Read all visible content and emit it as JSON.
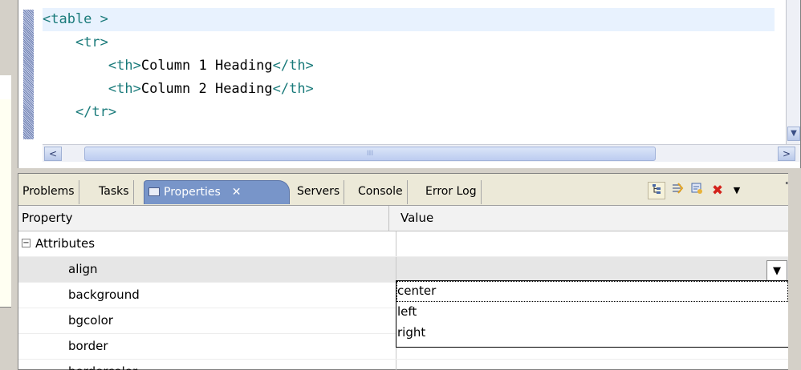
{
  "editor": {
    "lines": [
      {
        "indent": "",
        "tag": "<table >",
        "text": "",
        "close": ""
      },
      {
        "indent": "    ",
        "tag": "<tr>",
        "text": "",
        "close": ""
      },
      {
        "indent": "        ",
        "tag": "<th>",
        "text": "Column 1 Heading",
        "close": "</th>"
      },
      {
        "indent": "        ",
        "tag": "<th>",
        "text": "Column 2 Heading",
        "close": "</th>"
      },
      {
        "indent": "    ",
        "tag": "</tr>",
        "text": "",
        "close": ""
      }
    ],
    "hscroll_grip": "III",
    "left_arrow": "<",
    "right_arrow": ">"
  },
  "tabs": [
    {
      "label": "Problems",
      "active": false
    },
    {
      "label": "Tasks",
      "active": false
    },
    {
      "label": "Properties",
      "active": true
    },
    {
      "label": "Servers",
      "active": false
    },
    {
      "label": "Console",
      "active": false
    },
    {
      "label": "Error Log",
      "active": false
    }
  ],
  "toolbar": {
    "icons": [
      "show-categories-icon",
      "show-advanced-icon",
      "restore-default-icon",
      "remove-icon",
      "view-menu-icon"
    ],
    "remove_color": "#d3221b",
    "view_menu_glyph": "▼"
  },
  "properties_table": {
    "columns": [
      "Property",
      "Value"
    ],
    "group": "Attributes",
    "group_expander": "⊟",
    "rows": [
      {
        "name": "align",
        "value": "",
        "selected": true
      },
      {
        "name": "background",
        "value": ""
      },
      {
        "name": "bgcolor",
        "value": ""
      },
      {
        "name": "border",
        "value": ""
      },
      {
        "name": "bordercolor",
        "value": ""
      }
    ],
    "dropdown_glyph": "▼",
    "dropdown_options": [
      "center",
      "left",
      "right"
    ],
    "highlighted_option": "center"
  },
  "colors": {
    "tag_color": "#197a7a",
    "active_tab": "#7895c9",
    "current_line": "#e8f2fe"
  }
}
